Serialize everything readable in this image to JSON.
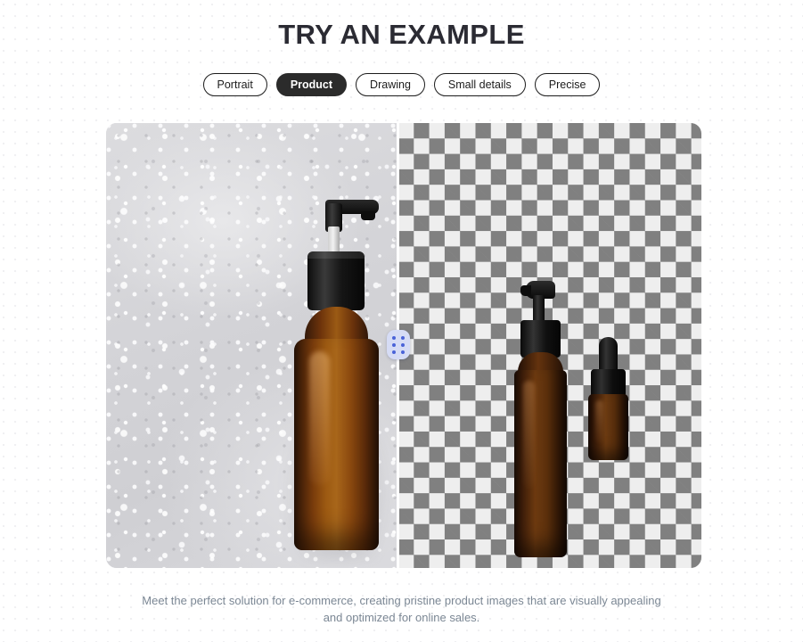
{
  "header": {
    "title": "TRY AN EXAMPLE"
  },
  "categories": {
    "items": [
      {
        "label": "Portrait",
        "active": false
      },
      {
        "label": "Product",
        "active": true
      },
      {
        "label": "Drawing",
        "active": false
      },
      {
        "label": "Small details",
        "active": false
      },
      {
        "label": "Precise",
        "active": false
      }
    ]
  },
  "comparison": {
    "left_pane": {
      "name": "original-product-photo",
      "description": "Amber glass pump bottle on textured white plaster surface"
    },
    "right_pane": {
      "name": "background-removed-result",
      "description": "Amber pump bottle and dropper bottle on transparent checkerboard"
    },
    "slider": {
      "name": "before-after-slider-handle",
      "handle_dot_count": 6
    },
    "colors": {
      "checker_dark": "#808080",
      "checker_light": "#eeeeee",
      "handle_background": "#d6dcf5",
      "handle_dots": "#4a63d8",
      "active_pill_background": "#2b2b2b",
      "title_color": "#2b2b33",
      "caption_color": "#7b8794"
    }
  },
  "caption": {
    "text": "Meet the perfect solution for e-commerce, creating pristine product images that are visually appealing and optimized for online sales."
  }
}
